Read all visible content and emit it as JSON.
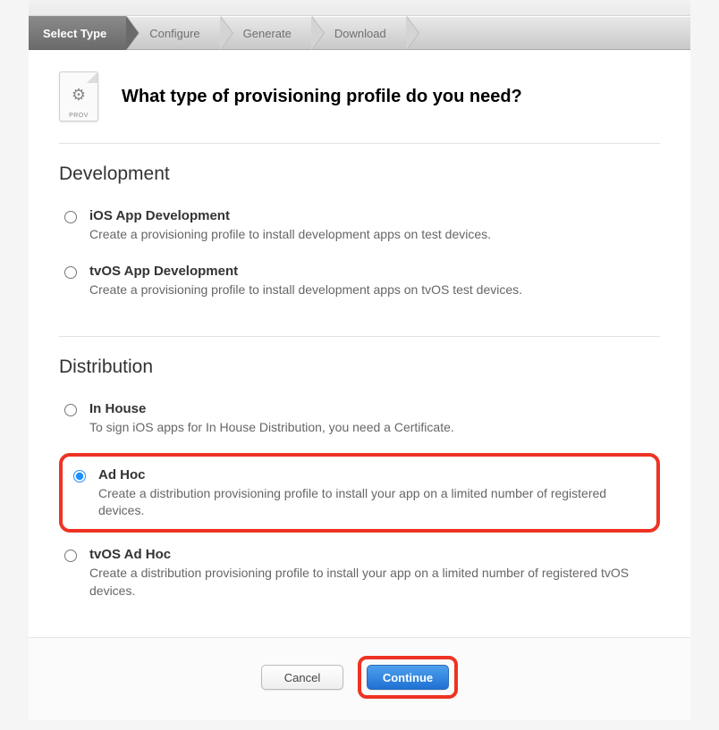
{
  "steps": [
    {
      "label": "Select Type",
      "active": true
    },
    {
      "label": "Configure",
      "active": false
    },
    {
      "label": "Generate",
      "active": false
    },
    {
      "label": "Download",
      "active": false
    }
  ],
  "prov_icon_label": "PROV",
  "heading": "What type of provisioning profile do you need?",
  "sections": {
    "dev": {
      "title": "Development",
      "options": [
        {
          "title": "iOS App Development",
          "desc": "Create a provisioning profile to install development apps on test devices.",
          "selected": false
        },
        {
          "title": "tvOS App Development",
          "desc": "Create a provisioning profile to install development apps on tvOS test devices.",
          "selected": false
        }
      ]
    },
    "dist": {
      "title": "Distribution",
      "options": [
        {
          "title": "In House",
          "desc": "To sign iOS apps for In House Distribution, you need a Certificate.",
          "selected": false
        },
        {
          "title": "Ad Hoc",
          "desc": "Create a distribution provisioning profile to install your app on a limited number of registered devices.",
          "selected": true
        },
        {
          "title": "tvOS Ad Hoc",
          "desc": "Create a distribution provisioning profile to install your app on a limited number of registered tvOS devices.",
          "selected": false
        }
      ]
    }
  },
  "buttons": {
    "cancel": "Cancel",
    "continue": "Continue"
  }
}
